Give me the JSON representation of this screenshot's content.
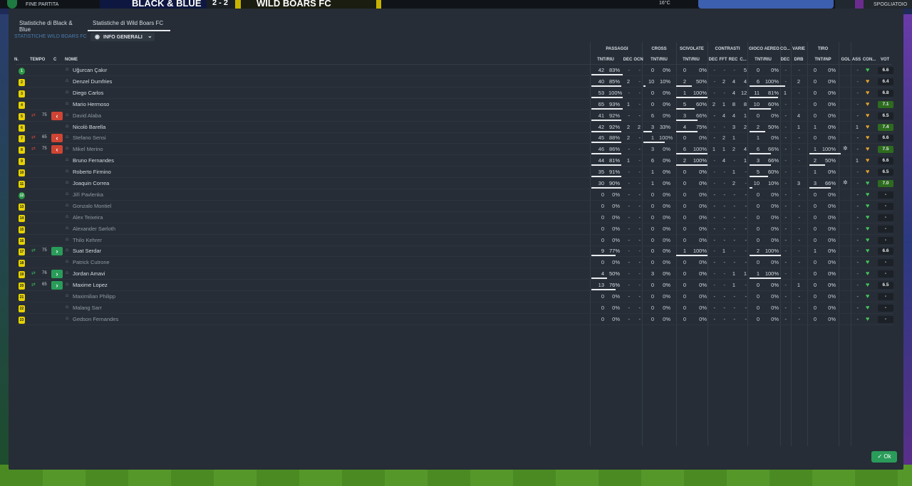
{
  "topbar": {
    "status": "FINE PARTITA",
    "home_team": "BLACK & BLUE",
    "score": "2 - 2",
    "away_team": "WILD BOARS FC",
    "weather": "16°C",
    "right_label": "SPOGLIATOIO"
  },
  "tabs": [
    {
      "label": "Statistiche di Black & Blue",
      "active": false
    },
    {
      "label": "Statistiche di Wild Boars FC",
      "active": true
    }
  ],
  "subnav": {
    "label": "STATISTICHE WILD BOARS FC",
    "dropdown": "INFO GENERALI"
  },
  "groups": [
    {
      "label": "PASSAGGI",
      "x": 0
    },
    {
      "label": "CROSS",
      "x": 0
    },
    {
      "label": "SCIVOLATE",
      "x": 0
    },
    {
      "label": "CONTRASTI",
      "x": 0
    },
    {
      "label": "GIOCO AEREO",
      "x": 0
    },
    {
      "label": "CO...",
      "x": 0
    },
    {
      "label": "VARIE",
      "x": 0
    },
    {
      "label": "TIRO",
      "x": 0
    }
  ],
  "columns": {
    "n": "N.",
    "tempo": "TEMPO",
    "c": "C",
    "nome": "NOME",
    "pass_tnt": "TNT/RIU",
    "pass_dec": "DEC",
    "pass_ocn": "OCN",
    "cross_tnt": "TNT/RIU",
    "scv_tnt": "TNT/RIU",
    "con_dec": "DEC",
    "con_fft": "FFT",
    "con_rec": "REC",
    "con_c": "C...",
    "air_tnt": "TNT/RIU",
    "co_dec": "DEC",
    "var_drb": "DRB",
    "tiro_tnt": "TNT/INP",
    "gol": "GOL",
    "ass": "ASS",
    "con": "CON...",
    "vot": "VOT"
  },
  "players": [
    {
      "n": "1",
      "gk": true,
      "sub": "",
      "min": "",
      "c": "",
      "name": "Uğurcan Çakır",
      "dim": false,
      "pt": "42",
      "pp": "83%",
      "pd": "-",
      "po": "-",
      "ct": "0",
      "cp": "0%",
      "st": "0",
      "sp": "0%",
      "cd": "-",
      "cf": "-",
      "cr": "-",
      "cc": "5",
      "at": "0",
      "ap": "0%",
      "od": "-",
      "dr": "-",
      "tt": "0",
      "tp": "0%",
      "gol": "",
      "ass": "-",
      "con": "green",
      "vot": "6.6",
      "vg": false,
      "gear": false,
      "pb": 44,
      "sb": 0,
      "ab": 0,
      "tb": 0,
      "cb": 0
    },
    {
      "n": "2",
      "gk": false,
      "sub": "",
      "min": "",
      "c": "",
      "name": "Denzel Dumfries",
      "dim": false,
      "pt": "40",
      "pp": "85%",
      "pd": "2",
      "po": "-",
      "ct": "10",
      "cp": "10%",
      "st": "2",
      "sp": "50%",
      "cd": "-",
      "cf": "2",
      "cr": "4",
      "cc": "4",
      "at": "6",
      "ap": "100%",
      "od": "-",
      "dr": "2",
      "tt": "0",
      "tp": "0%",
      "gol": "",
      "ass": "-",
      "con": "orange",
      "vot": "6.4",
      "vg": false,
      "gear": false,
      "pb": 42,
      "sb": 22,
      "ab": 50,
      "tb": 0,
      "cb": 3
    },
    {
      "n": "3",
      "gk": false,
      "sub": "",
      "min": "",
      "c": "",
      "name": "Diego Carlos",
      "dim": false,
      "pt": "53",
      "pp": "100%",
      "pd": "-",
      "po": "-",
      "ct": "0",
      "cp": "0%",
      "st": "1",
      "sp": "100%",
      "cd": "-",
      "cf": "-",
      "cr": "4",
      "cc": "12",
      "at": "11",
      "ap": "81%",
      "od": "1",
      "dr": "-",
      "tt": "0",
      "tp": "0%",
      "gol": "",
      "ass": "-",
      "con": "orange",
      "vot": "6.8",
      "vg": false,
      "gear": false,
      "pb": 44,
      "sb": 44,
      "ab": 40,
      "tb": 0,
      "cb": 0
    },
    {
      "n": "4",
      "gk": false,
      "sub": "",
      "min": "",
      "c": "",
      "name": "Mario Hermoso",
      "dim": false,
      "pt": "65",
      "pp": "93%",
      "pd": "1",
      "po": "-",
      "ct": "0",
      "cp": "0%",
      "st": "5",
      "sp": "60%",
      "cd": "2",
      "cf": "1",
      "cr": "8",
      "cc": "8",
      "at": "10",
      "ap": "60%",
      "od": "-",
      "dr": "-",
      "tt": "0",
      "tp": "0%",
      "gol": "",
      "ass": "-",
      "con": "orange",
      "vot": "7.1",
      "vg": true,
      "gear": false,
      "pb": 44,
      "sb": 26,
      "ab": 30,
      "tb": 0,
      "cb": 0
    },
    {
      "n": "5",
      "gk": false,
      "sub": "out",
      "min": "75",
      "c": "out",
      "name": "David Alaba",
      "dim": true,
      "pt": "41",
      "pp": "92%",
      "pd": "-",
      "po": "-",
      "ct": "6",
      "cp": "0%",
      "st": "3",
      "sp": "66%",
      "cd": "-",
      "cf": "4",
      "cr": "4",
      "cc": "1",
      "at": "0",
      "ap": "0%",
      "od": "-",
      "dr": "4",
      "tt": "0",
      "tp": "0%",
      "gol": "",
      "ass": "-",
      "con": "orange",
      "vot": "6.5",
      "vg": false,
      "gear": false,
      "pb": 42,
      "sb": 30,
      "ab": 0,
      "tb": 0,
      "cb": 0
    },
    {
      "n": "6",
      "gk": false,
      "sub": "",
      "min": "",
      "c": "",
      "name": "Nicolò Barella",
      "dim": false,
      "pt": "42",
      "pp": "92%",
      "pd": "2",
      "po": "2",
      "ct": "3",
      "cp": "33%",
      "st": "4",
      "sp": "75%",
      "cd": "-",
      "cf": "-",
      "cr": "3",
      "cc": "2",
      "at": "2",
      "ap": "50%",
      "od": "-",
      "dr": "1",
      "tt": "1",
      "tp": "0%",
      "gol": "",
      "ass": "1",
      "con": "orange",
      "vot": "7.4",
      "vg": true,
      "gear": false,
      "pb": 42,
      "sb": 30,
      "ab": 22,
      "tb": 0,
      "cb": 12
    },
    {
      "n": "7",
      "gk": false,
      "sub": "out",
      "min": "65",
      "c": "out",
      "name": "Stefano Sensi",
      "dim": true,
      "pt": "45",
      "pp": "88%",
      "pd": "2",
      "po": "-",
      "ct": "1",
      "cp": "100%",
      "st": "0",
      "sp": "0%",
      "cd": "-",
      "cf": "2",
      "cr": "1",
      "cc": "",
      "at": "1",
      "ap": "0%",
      "od": "-",
      "dr": "-",
      "tt": "0",
      "tp": "0%",
      "gol": "",
      "ass": "-",
      "con": "orange",
      "vot": "6.6",
      "vg": false,
      "gear": false,
      "pb": 42,
      "sb": 0,
      "ab": 0,
      "tb": 0,
      "cb": 30
    },
    {
      "n": "8",
      "gk": false,
      "sub": "out",
      "min": "75",
      "c": "out",
      "name": "Mikel Merino",
      "dim": true,
      "pt": "46",
      "pp": "86%",
      "pd": "-",
      "po": "-",
      "ct": "3",
      "cp": "0%",
      "st": "6",
      "sp": "100%",
      "cd": "1",
      "cf": "1",
      "cr": "2",
      "cc": "4",
      "at": "6",
      "ap": "66%",
      "od": "-",
      "dr": "-",
      "tt": "1",
      "tp": "100%",
      "gol": "",
      "ass": "-",
      "con": "orange",
      "vot": "7.5",
      "vg": true,
      "gear": true,
      "pb": 42,
      "sb": 44,
      "ab": 30,
      "tb": 44,
      "cb": 0
    },
    {
      "n": "9",
      "gk": false,
      "sub": "",
      "min": "",
      "c": "",
      "name": "Bruno Fernandes",
      "dim": false,
      "pt": "44",
      "pp": "81%",
      "pd": "1",
      "po": "-",
      "ct": "6",
      "cp": "0%",
      "st": "2",
      "sp": "100%",
      "cd": "-",
      "cf": "4",
      "cr": "-",
      "cc": "1",
      "at": "3",
      "ap": "66%",
      "od": "-",
      "dr": "-",
      "tt": "2",
      "tp": "50%",
      "gol": "",
      "ass": "1",
      "con": "orange",
      "vot": "6.6",
      "vg": false,
      "gear": false,
      "pb": 42,
      "sb": 44,
      "ab": 30,
      "tb": 22,
      "cb": 0
    },
    {
      "n": "10",
      "gk": false,
      "sub": "",
      "min": "",
      "c": "",
      "name": "Roberto Firmino",
      "dim": false,
      "pt": "35",
      "pp": "91%",
      "pd": "-",
      "po": "-",
      "ct": "1",
      "cp": "0%",
      "st": "0",
      "sp": "0%",
      "cd": "-",
      "cf": "-",
      "cr": "1",
      "cc": "-",
      "at": "5",
      "ap": "60%",
      "od": "-",
      "dr": "-",
      "tt": "1",
      "tp": "0%",
      "gol": "",
      "ass": "-",
      "con": "orange",
      "vot": "6.5",
      "vg": false,
      "gear": false,
      "pb": 42,
      "sb": 0,
      "ab": 26,
      "tb": 0,
      "cb": 0
    },
    {
      "n": "11",
      "gk": false,
      "sub": "",
      "min": "",
      "c": "",
      "name": "Joaquin Correa",
      "dim": false,
      "pt": "30",
      "pp": "90%",
      "pd": "-",
      "po": "-",
      "ct": "1",
      "cp": "0%",
      "st": "0",
      "sp": "0%",
      "cd": "-",
      "cf": "-",
      "cr": "2",
      "cc": "-",
      "at": "10",
      "ap": "10%",
      "od": "-",
      "dr": "3",
      "tt": "3",
      "tp": "66%",
      "gol": "",
      "ass": "-",
      "con": "green",
      "vot": "7.0",
      "vg": true,
      "gear": true,
      "pb": 42,
      "sb": 0,
      "ab": 4,
      "tb": 30,
      "cb": 0
    },
    {
      "n": "12",
      "gk": true,
      "sub": "",
      "min": "",
      "c": "",
      "name": "Jiří Pavlenka",
      "dim": true,
      "pt": "0",
      "pp": "0%",
      "pd": "-",
      "po": "-",
      "ct": "0",
      "cp": "0%",
      "st": "0",
      "sp": "0%",
      "cd": "-",
      "cf": "-",
      "cr": "-",
      "cc": "-",
      "at": "0",
      "ap": "0%",
      "od": "-",
      "dr": "-",
      "tt": "0",
      "tp": "0%",
      "gol": "",
      "ass": "-",
      "con": "green",
      "vot": "-",
      "vg": false,
      "gear": false,
      "pb": 0,
      "sb": 0,
      "ab": 0,
      "tb": 0,
      "cb": 0
    },
    {
      "n": "13",
      "gk": false,
      "sub": "",
      "min": "",
      "c": "",
      "name": "Gonzalo Montiel",
      "dim": true,
      "pt": "0",
      "pp": "0%",
      "pd": "-",
      "po": "-",
      "ct": "0",
      "cp": "0%",
      "st": "0",
      "sp": "0%",
      "cd": "-",
      "cf": "-",
      "cr": "-",
      "cc": "-",
      "at": "0",
      "ap": "0%",
      "od": "-",
      "dr": "-",
      "tt": "0",
      "tp": "0%",
      "gol": "",
      "ass": "-",
      "con": "green",
      "vot": "-",
      "vg": false,
      "gear": false,
      "pb": 0,
      "sb": 0,
      "ab": 0,
      "tb": 0,
      "cb": 0
    },
    {
      "n": "14",
      "gk": false,
      "sub": "",
      "min": "",
      "c": "",
      "name": "Alex Teixeira",
      "dim": true,
      "pt": "0",
      "pp": "0%",
      "pd": "-",
      "po": "-",
      "ct": "0",
      "cp": "0%",
      "st": "0",
      "sp": "0%",
      "cd": "-",
      "cf": "-",
      "cr": "-",
      "cc": "-",
      "at": "0",
      "ap": "0%",
      "od": "-",
      "dr": "-",
      "tt": "0",
      "tp": "0%",
      "gol": "",
      "ass": "-",
      "con": "green",
      "vot": "-",
      "vg": false,
      "gear": false,
      "pb": 0,
      "sb": 0,
      "ab": 0,
      "tb": 0,
      "cb": 0
    },
    {
      "n": "15",
      "gk": false,
      "sub": "",
      "min": "",
      "c": "",
      "name": "Alexander Sørloth",
      "dim": true,
      "pt": "0",
      "pp": "0%",
      "pd": "-",
      "po": "-",
      "ct": "0",
      "cp": "0%",
      "st": "0",
      "sp": "0%",
      "cd": "-",
      "cf": "-",
      "cr": "-",
      "cc": "-",
      "at": "0",
      "ap": "0%",
      "od": "-",
      "dr": "-",
      "tt": "0",
      "tp": "0%",
      "gol": "",
      "ass": "-",
      "con": "green",
      "vot": "-",
      "vg": false,
      "gear": false,
      "pb": 0,
      "sb": 0,
      "ab": 0,
      "tb": 0,
      "cb": 0
    },
    {
      "n": "16",
      "gk": false,
      "sub": "",
      "min": "",
      "c": "",
      "name": "Thilo Kehrer",
      "dim": true,
      "pt": "0",
      "pp": "0%",
      "pd": "-",
      "po": "-",
      "ct": "0",
      "cp": "0%",
      "st": "0",
      "sp": "0%",
      "cd": "-",
      "cf": "-",
      "cr": "-",
      "cc": "-",
      "at": "0",
      "ap": "0%",
      "od": "-",
      "dr": "-",
      "tt": "0",
      "tp": "0%",
      "gol": "",
      "ass": "-",
      "con": "green",
      "vot": "-",
      "vg": false,
      "gear": false,
      "pb": 0,
      "sb": 0,
      "ab": 0,
      "tb": 0,
      "cb": 0
    },
    {
      "n": "17",
      "gk": false,
      "sub": "in",
      "min": "75",
      "c": "in",
      "name": "Suat Serdar",
      "dim": false,
      "pt": "9",
      "pp": "77%",
      "pd": "-",
      "po": "-",
      "ct": "0",
      "cp": "0%",
      "st": "1",
      "sp": "100%",
      "cd": "-",
      "cf": "1",
      "cr": "-",
      "cc": "-",
      "at": "2",
      "ap": "100%",
      "od": "-",
      "dr": "-",
      "tt": "1",
      "tp": "0%",
      "gol": "",
      "ass": "-",
      "con": "green",
      "vot": "6.6",
      "vg": false,
      "gear": false,
      "pb": 34,
      "sb": 44,
      "ab": 44,
      "tb": 0,
      "cb": 0
    },
    {
      "n": "18",
      "gk": false,
      "sub": "",
      "min": "",
      "c": "",
      "name": "Patrick Cutrone",
      "dim": true,
      "pt": "0",
      "pp": "0%",
      "pd": "-",
      "po": "-",
      "ct": "0",
      "cp": "0%",
      "st": "0",
      "sp": "0%",
      "cd": "-",
      "cf": "-",
      "cr": "-",
      "cc": "-",
      "at": "0",
      "ap": "0%",
      "od": "-",
      "dr": "-",
      "tt": "0",
      "tp": "0%",
      "gol": "",
      "ass": "-",
      "con": "green",
      "vot": "-",
      "vg": false,
      "gear": false,
      "pb": 0,
      "sb": 0,
      "ab": 0,
      "tb": 0,
      "cb": 0
    },
    {
      "n": "19",
      "gk": false,
      "sub": "in",
      "min": "76",
      "c": "in",
      "name": "Jordan Amavi",
      "dim": false,
      "pt": "4",
      "pp": "50%",
      "pd": "-",
      "po": "-",
      "ct": "3",
      "cp": "0%",
      "st": "0",
      "sp": "0%",
      "cd": "-",
      "cf": "-",
      "cr": "1",
      "cc": "1",
      "at": "1",
      "ap": "100%",
      "od": "-",
      "dr": "-",
      "tt": "0",
      "tp": "0%",
      "gol": "",
      "ass": "-",
      "con": "green",
      "vot": "-",
      "vg": false,
      "gear": false,
      "pb": 22,
      "sb": 0,
      "ab": 44,
      "tb": 0,
      "cb": 0
    },
    {
      "n": "20",
      "gk": false,
      "sub": "in",
      "min": "65",
      "c": "in",
      "name": "Maxime Lopez",
      "dim": false,
      "pt": "13",
      "pp": "76%",
      "pd": "-",
      "po": "-",
      "ct": "0",
      "cp": "0%",
      "st": "0",
      "sp": "0%",
      "cd": "-",
      "cf": "-",
      "cr": "1",
      "cc": "-",
      "at": "0",
      "ap": "0%",
      "od": "-",
      "dr": "1",
      "tt": "0",
      "tp": "0%",
      "gol": "",
      "ass": "-",
      "con": "green",
      "vot": "6.5",
      "vg": false,
      "gear": false,
      "pb": 34,
      "sb": 0,
      "ab": 0,
      "tb": 0,
      "cb": 0
    },
    {
      "n": "21",
      "gk": false,
      "sub": "",
      "min": "",
      "c": "",
      "name": "Maximilian Philipp",
      "dim": true,
      "pt": "0",
      "pp": "0%",
      "pd": "-",
      "po": "-",
      "ct": "0",
      "cp": "0%",
      "st": "0",
      "sp": "0%",
      "cd": "-",
      "cf": "-",
      "cr": "-",
      "cc": "-",
      "at": "0",
      "ap": "0%",
      "od": "-",
      "dr": "-",
      "tt": "0",
      "tp": "0%",
      "gol": "",
      "ass": "-",
      "con": "green",
      "vot": "-",
      "vg": false,
      "gear": false,
      "pb": 0,
      "sb": 0,
      "ab": 0,
      "tb": 0,
      "cb": 0
    },
    {
      "n": "22",
      "gk": false,
      "sub": "",
      "min": "",
      "c": "",
      "name": "Malang Sarr",
      "dim": true,
      "pt": "0",
      "pp": "0%",
      "pd": "-",
      "po": "-",
      "ct": "0",
      "cp": "0%",
      "st": "0",
      "sp": "0%",
      "cd": "-",
      "cf": "-",
      "cr": "-",
      "cc": "-",
      "at": "0",
      "ap": "0%",
      "od": "-",
      "dr": "-",
      "tt": "0",
      "tp": "0%",
      "gol": "",
      "ass": "-",
      "con": "green",
      "vot": "-",
      "vg": false,
      "gear": false,
      "pb": 0,
      "sb": 0,
      "ab": 0,
      "tb": 0,
      "cb": 0
    },
    {
      "n": "23",
      "gk": false,
      "sub": "",
      "min": "",
      "c": "",
      "name": "Gedson Fernandes",
      "dim": true,
      "pt": "0",
      "pp": "0%",
      "pd": "-",
      "po": "-",
      "ct": "0",
      "cp": "0%",
      "st": "0",
      "sp": "0%",
      "cd": "-",
      "cf": "-",
      "cr": "-",
      "cc": "-",
      "at": "0",
      "ap": "0%",
      "od": "-",
      "dr": "-",
      "tt": "0",
      "tp": "0%",
      "gol": "",
      "ass": "-",
      "con": "green",
      "vot": "-",
      "vg": false,
      "gear": false,
      "pb": 0,
      "sb": 0,
      "ab": 0,
      "tb": 0,
      "cb": 0
    }
  ],
  "ok_button": "Ok",
  "colors": {
    "accent": "#2a9c5a",
    "sub_out": "#d04434",
    "position": "#e6d200",
    "subnav": "#4a7cb0"
  }
}
